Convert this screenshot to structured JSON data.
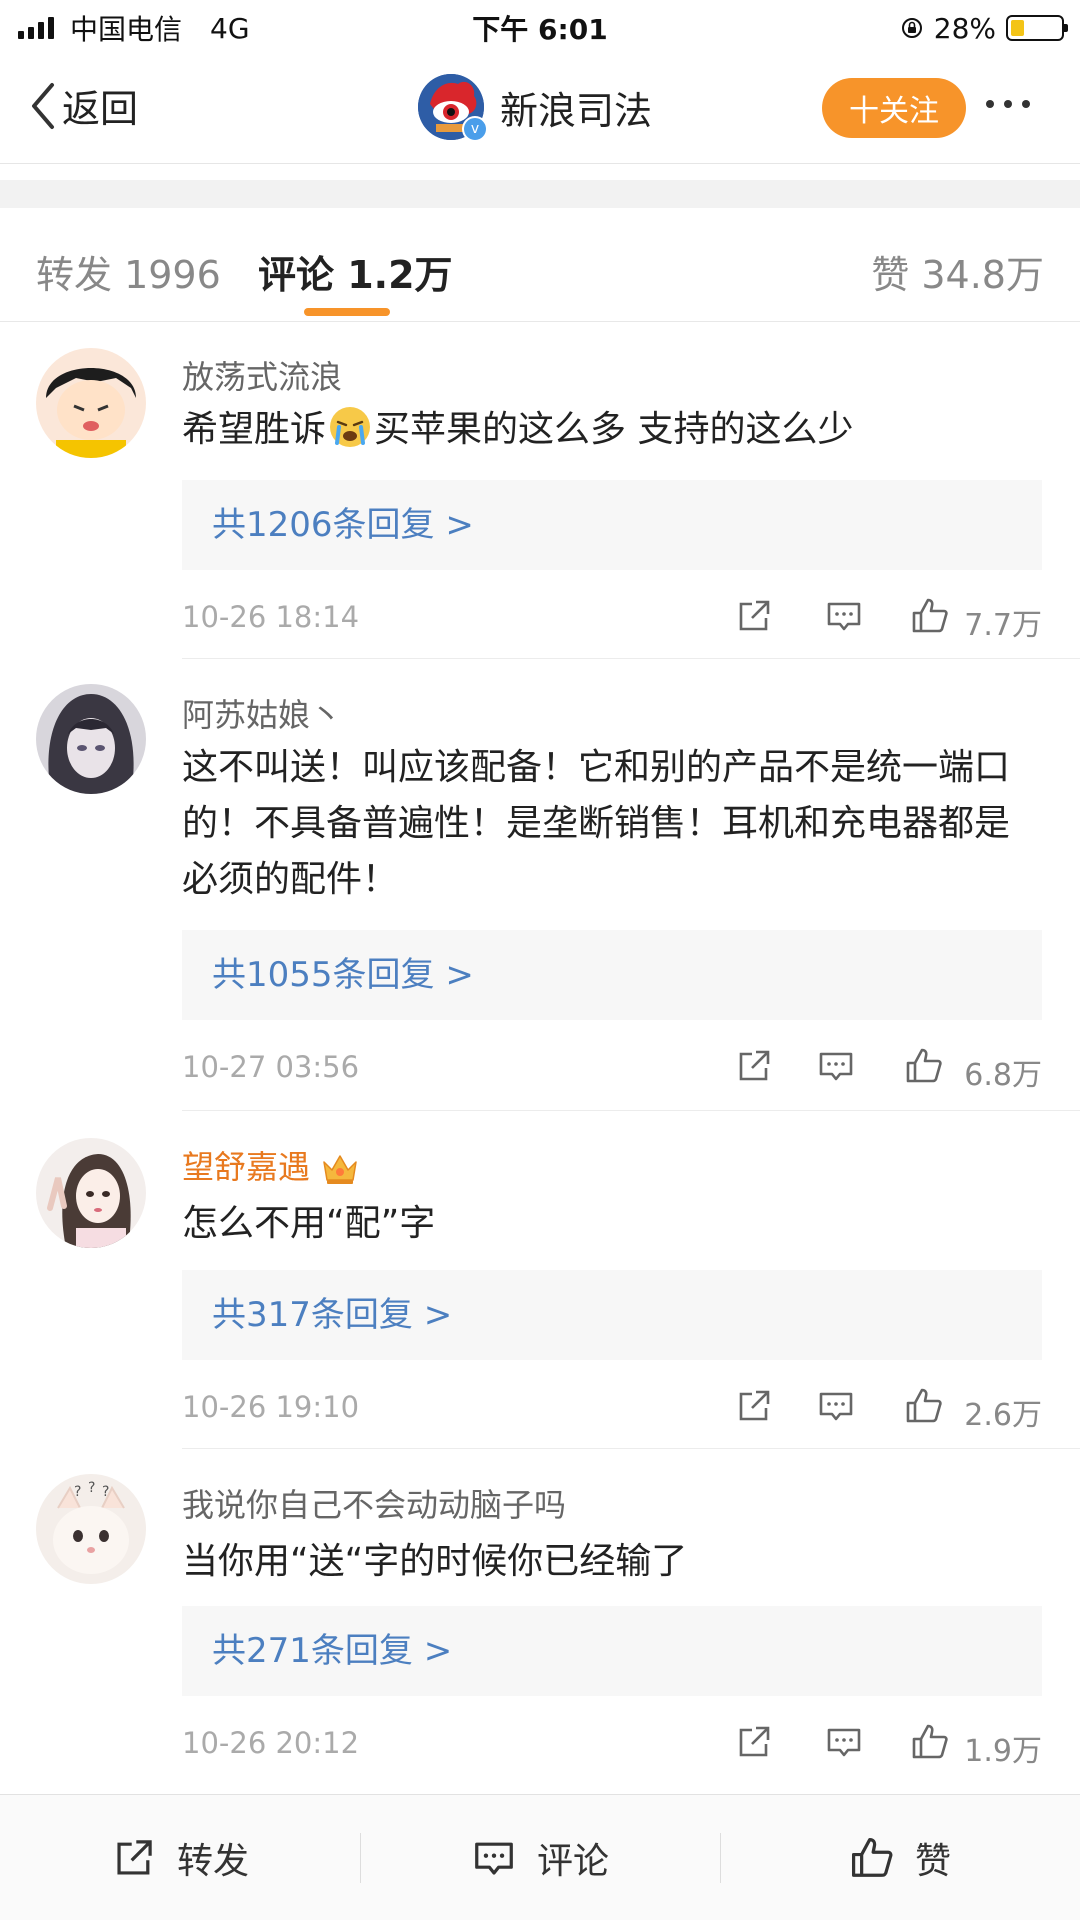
{
  "status_bar": {
    "carrier": "中国电信",
    "network": "4G",
    "time": "下午 6:01",
    "battery": "28%",
    "battery_level": 0.28
  },
  "nav": {
    "back_label": "返回",
    "title": "新浪司法",
    "follow_label": "十关注"
  },
  "tabs": [
    {
      "label": "转发 1996",
      "active": false
    },
    {
      "label": "评论 1.2万",
      "active": true
    },
    {
      "label": "赞 34.8万",
      "active": false
    }
  ],
  "comments": [
    {
      "user": "放荡式流浪",
      "text_a": "希望胜诉",
      "text_b": "买苹果的这么多   支持的这么少",
      "emoji": "crying-face-icon",
      "replies": "共1206条回复 >",
      "time": "10-26 18:14",
      "likes": "7.7万"
    },
    {
      "user": "阿苏姑娘丶",
      "text": "这不叫送！叫应该配备！它和别的产品不是统一端口的！不具备普遍性！是垄断销售！耳机和充电器都是必须的配件！",
      "replies": "共1055条回复 >",
      "time": "10-27 03:56",
      "likes": "6.8万"
    },
    {
      "user": "望舒嘉遇",
      "badge": "crown-icon",
      "text": "怎么不用“配”字",
      "replies": "共317条回复 >",
      "time": "10-26 19:10",
      "likes": "2.6万"
    },
    {
      "user": "我说你自己不会动动脑子吗",
      "text": "当你用“送“字的时候你已经输了",
      "replies": "共271条回复 >",
      "time": "10-26 20:12",
      "likes": "1.9万"
    }
  ],
  "bottom_bar": {
    "repost": "转发",
    "comment": "评论",
    "like": "赞"
  },
  "colors": {
    "accent_orange": "#f7942a",
    "link_blue": "#4c7fc0",
    "vip_orange": "#e8791f"
  }
}
